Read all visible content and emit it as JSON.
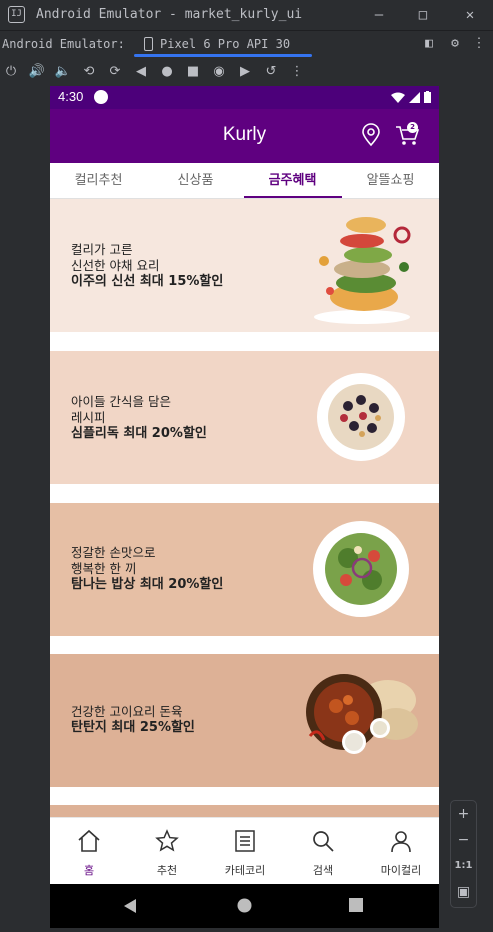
{
  "ide": {
    "window_title": "Android Emulator - market_kurly_ui",
    "app_icon_label": "IJ",
    "tool_label": "Android Emulator:",
    "device_tab": "Pixel 6 Pro API 30",
    "zoom_in": "+",
    "zoom_out": "−",
    "zoom_reset": "1:1"
  },
  "status_bar": {
    "time": "4:30"
  },
  "app_bar": {
    "title": "Kurly",
    "cart_count": "2"
  },
  "tabs": [
    {
      "label": "컬리추천",
      "active": false
    },
    {
      "label": "신상품",
      "active": false
    },
    {
      "label": "금주혜택",
      "active": true
    },
    {
      "label": "알뜰쇼핑",
      "active": false
    }
  ],
  "banners": [
    {
      "line1": "컬리가 고른",
      "line2": "신선한 야채 요리",
      "headline": "이주의 신선 최대 15%할인",
      "bg": "#f6e7de",
      "image": "salad-tower"
    },
    {
      "line1": "아이들 간식을 담은",
      "line2": "레시피",
      "headline": "심플리독 최대 20%할인",
      "bg": "#f1d6c6",
      "image": "berry-bowl"
    },
    {
      "line1": "정갈한 손맛으로",
      "line2": "행복한 한 끼",
      "headline": "탐나는 밥상 최대 20%할인",
      "bg": "#e6bfa5",
      "image": "salad-plate"
    },
    {
      "line1": "",
      "line2": "건강한 고이요리 돈육",
      "headline": "탄탄지 최대 25%할인",
      "bg": "#ddb196",
      "image": "curry-naan"
    }
  ],
  "bottom_nav": [
    {
      "label": "홈",
      "icon": "home-icon",
      "selected": true
    },
    {
      "label": "추천",
      "icon": "star-icon",
      "selected": false
    },
    {
      "label": "카테코리",
      "icon": "category-icon",
      "selected": false
    },
    {
      "label": "검색",
      "icon": "search-icon",
      "selected": false
    },
    {
      "label": "마이컬리",
      "icon": "person-icon",
      "selected": false
    }
  ],
  "colors": {
    "primary": "#5f0080",
    "status": "#4c007a",
    "ide_bg": "#2b2d30",
    "accent": "#3574f0"
  }
}
